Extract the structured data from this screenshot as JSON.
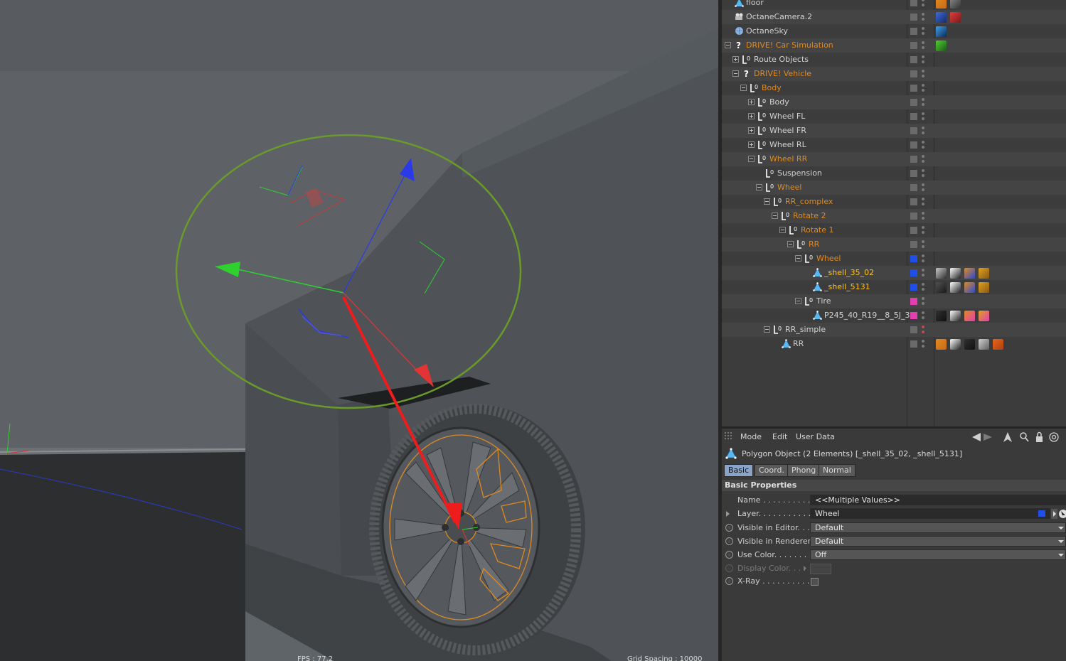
{
  "viewport": {
    "fps_label": "FPS : 77.2",
    "grid_label": "Grid Spacing : 10000"
  },
  "object_manager": {
    "rows": [
      {
        "name": "floor",
        "color": "white",
        "icon": "polygon-icon"
      },
      {
        "name": "OctaneCamera.2",
        "color": "white",
        "icon": "camera-icon"
      },
      {
        "name": "OctaneSky",
        "color": "white",
        "icon": "sky-icon"
      },
      {
        "name": "DRIVE! Car Simulation",
        "color": "orange",
        "icon": "unknown-icon"
      },
      {
        "name": "Route Objects",
        "color": "white",
        "icon": "null-icon"
      },
      {
        "name": "DRIVE! Vehicle",
        "color": "orange",
        "icon": "unknown-icon"
      },
      {
        "name": "Body",
        "color": "orange",
        "icon": "null-icon"
      },
      {
        "name": "Body",
        "color": "white",
        "icon": "null-icon"
      },
      {
        "name": "Wheel FL",
        "color": "white",
        "icon": "null-icon"
      },
      {
        "name": "Wheel FR",
        "color": "white",
        "icon": "null-icon"
      },
      {
        "name": "Wheel RL",
        "color": "white",
        "icon": "null-icon"
      },
      {
        "name": "Wheel RR",
        "color": "orange",
        "icon": "null-icon"
      },
      {
        "name": "Suspension",
        "color": "white",
        "icon": "null-icon"
      },
      {
        "name": "Wheel",
        "color": "orange",
        "icon": "null-icon"
      },
      {
        "name": "RR_complex",
        "color": "orange",
        "icon": "null-icon"
      },
      {
        "name": "Rotate 2",
        "color": "orange",
        "icon": "null-icon"
      },
      {
        "name": "Rotate 1",
        "color": "orange",
        "icon": "null-icon"
      },
      {
        "name": "RR",
        "color": "orange",
        "icon": "null-icon"
      },
      {
        "name": "Wheel",
        "color": "orange",
        "icon": "null-icon"
      },
      {
        "name": "_shell_35_02",
        "color": "yellow",
        "icon": "polygon-icon"
      },
      {
        "name": "_shell_5131",
        "color": "yellow",
        "icon": "polygon-icon"
      },
      {
        "name": "Tire",
        "color": "white",
        "icon": "null-icon"
      },
      {
        "name": "P245_40_R19__8_5J_3",
        "color": "white",
        "icon": "polygon-icon"
      },
      {
        "name": "RR_simple",
        "color": "white",
        "icon": "null-icon"
      },
      {
        "name": "RR",
        "color": "white",
        "icon": "polygon-icon"
      }
    ],
    "colors": {
      "orange": "#e08a1e",
      "yellow": "#ffc226",
      "layer_blue": "#1f4fe8",
      "layer_pink": "#e23fb0"
    }
  },
  "attribute_manager": {
    "menu": [
      "Mode",
      "Edit",
      "User Data"
    ],
    "object_title": "Polygon Object (2 Elements) [_shell_35_02, _shell_5131]",
    "tabs": [
      "Basic",
      "Coord.",
      "Phong",
      "Normal"
    ],
    "section": "Basic Properties",
    "props": {
      "name_label": "Name . . . . . . . . . . . .",
      "name_value": "<<Multiple Values>>",
      "layer_label": "Layer. . . . . . . . . . . .",
      "layer_value": "Wheel",
      "vis_editor_label": "Visible in Editor. . .",
      "vis_editor_value": "Default",
      "vis_render_label": "Visible in Renderer",
      "vis_render_value": "Default",
      "use_color_label": "Use Color. . . . . . . .",
      "use_color_value": "Off",
      "display_color_label": "Display Color. . . .",
      "xray_label": "X-Ray . . . . . . . . . . ."
    }
  }
}
